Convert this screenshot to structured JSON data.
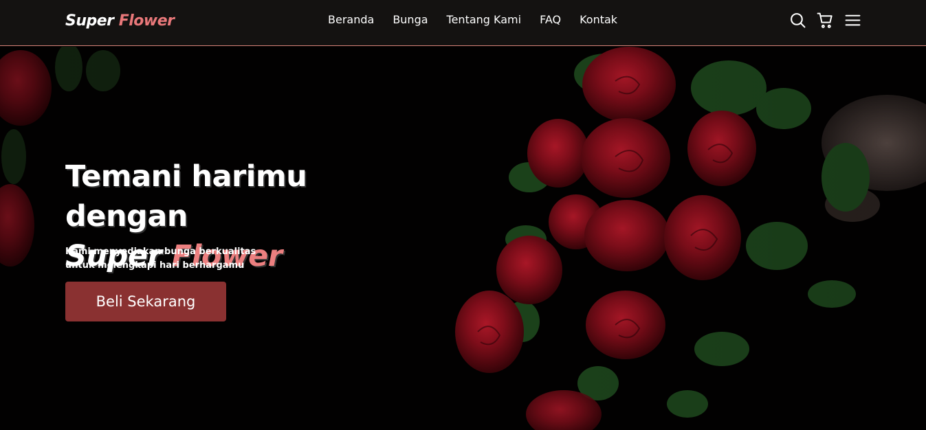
{
  "brand": {
    "part1": "Super",
    "part2": "Flower"
  },
  "nav": {
    "links": [
      {
        "label": "Beranda"
      },
      {
        "label": "Bunga"
      },
      {
        "label": "Tentang Kami"
      },
      {
        "label": "FAQ"
      },
      {
        "label": "Kontak"
      }
    ],
    "icons": [
      "search-icon",
      "cart-icon",
      "menu-icon"
    ]
  },
  "hero": {
    "title_line1": "Temani harimu",
    "title_line2": "dengan",
    "brand_part1": "Super",
    "brand_part2": "Flower",
    "subtitle_line1": "Kami menyediakan bunga berkualitas",
    "subtitle_line2": "untuk melengkapi hari berhargamu",
    "cta_label": "Beli Sekarang"
  },
  "colors": {
    "accent": "#e9787a",
    "button": "#8a3131",
    "navbar_bg": "#141211",
    "navbar_border": "#d9847a"
  }
}
